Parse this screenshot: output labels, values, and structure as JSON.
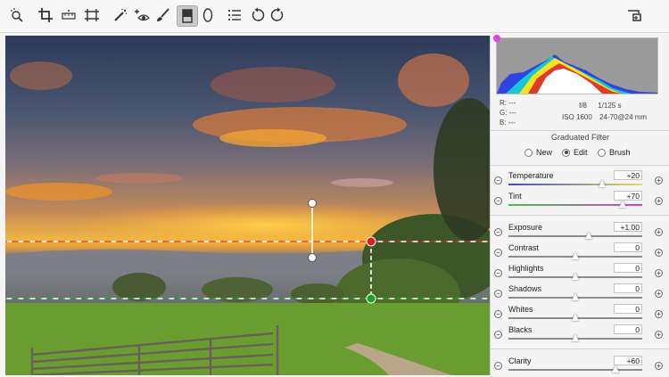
{
  "toolbar": {
    "tools": [
      {
        "name": "zoom-tool-icon"
      },
      {
        "name": "crop-tool-icon"
      },
      {
        "name": "straighten-tool-icon"
      },
      {
        "name": "transform-tool-icon"
      },
      {
        "name": "spot-removal-icon"
      },
      {
        "name": "red-eye-icon"
      },
      {
        "name": "adjustment-brush-icon"
      },
      {
        "name": "graduated-filter-icon",
        "active": true
      },
      {
        "name": "radial-filter-icon"
      },
      {
        "name": "preferences-list-icon"
      },
      {
        "name": "rotate-left-icon"
      },
      {
        "name": "rotate-right-icon"
      },
      {
        "name": "toggle-fullscreen-icon"
      }
    ]
  },
  "readout": {
    "r": "R:  ---",
    "g": "G:  ---",
    "b": "B:  ---",
    "aperture": "f/8",
    "shutter": "1/125 s",
    "iso": "ISO 1600",
    "lens": "24-70@24 mm"
  },
  "filter": {
    "title": "Graduated Filter",
    "modes": [
      {
        "label": "New",
        "selected": false
      },
      {
        "label": "Edit",
        "selected": true
      },
      {
        "label": "Brush",
        "selected": false
      }
    ]
  },
  "sliders": [
    {
      "label": "Temperature",
      "value": "+20",
      "position": 0.7,
      "track": "temp"
    },
    {
      "label": "Tint",
      "value": "+70",
      "position": 0.85,
      "track": "tint"
    },
    {
      "label": "Exposure",
      "value": "+1.00",
      "position": 0.6,
      "track": "gray"
    },
    {
      "label": "Contrast",
      "value": "0",
      "position": 0.5,
      "track": "gray"
    },
    {
      "label": "Highlights",
      "value": "0",
      "position": 0.5,
      "track": "gray"
    },
    {
      "label": "Shadows",
      "value": "0",
      "position": 0.5,
      "track": "gray"
    },
    {
      "label": "Whites",
      "value": "0",
      "position": 0.5,
      "track": "gray"
    },
    {
      "label": "Blacks",
      "value": "0",
      "position": 0.5,
      "track": "gray"
    },
    {
      "label": "Clarity",
      "value": "+60",
      "position": 0.8,
      "track": "gray"
    }
  ],
  "colors": {
    "active_pin": "#d9221c",
    "secondary_pin": "#1aa31e",
    "clipping_marker": "#e040e0"
  }
}
